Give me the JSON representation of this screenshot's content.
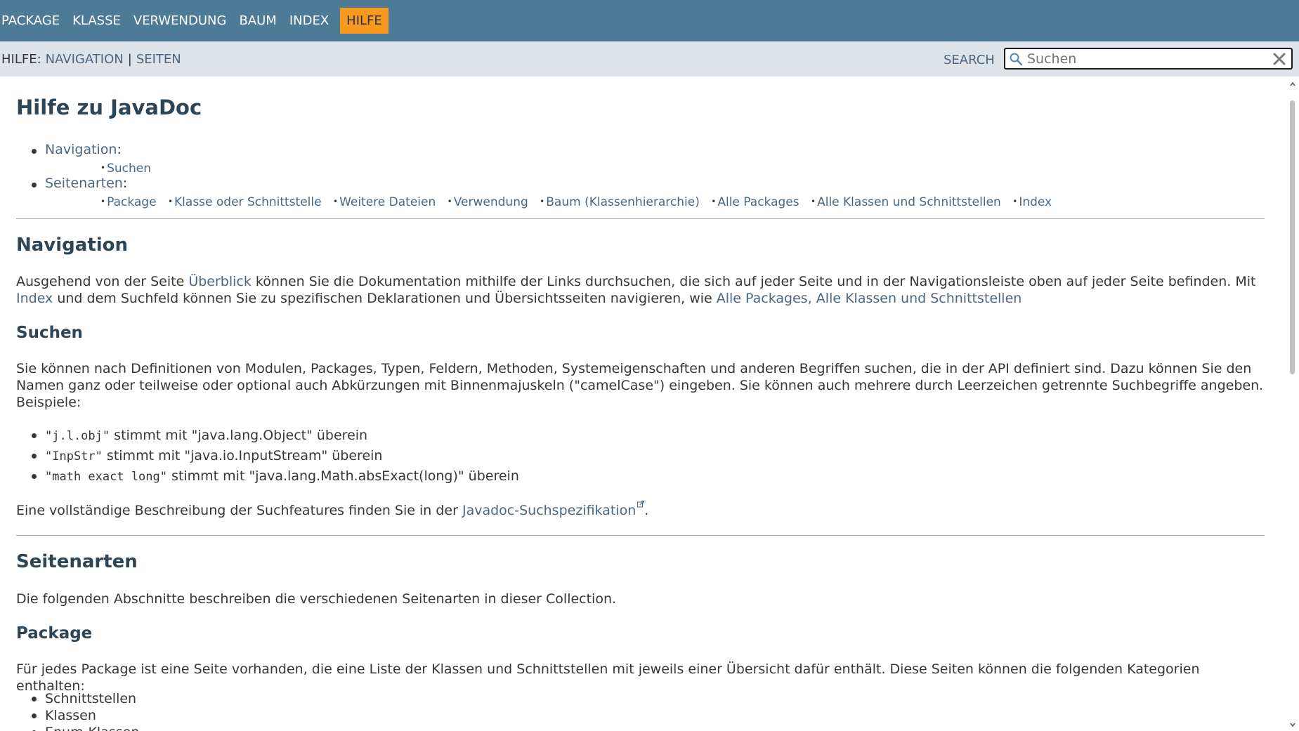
{
  "topnav": {
    "items": [
      "PACKAGE",
      "KLASSE",
      "VERWENDUNG",
      "BAUM",
      "INDEX"
    ],
    "active": "HILFE"
  },
  "subnav": {
    "help_prefix": "HILFE:",
    "nav_link": "NAVIGATION",
    "separator": "|",
    "pages_link": "SEITEN",
    "search_label": "SEARCH",
    "search_placeholder": "Suchen"
  },
  "page_title": "Hilfe zu JavaDoc",
  "toc": {
    "navigation_label": "Navigation",
    "navigation_items": [
      "Suchen"
    ],
    "pages_label": "Seitenarten",
    "pages_items": [
      "Package",
      "Klasse oder Schnittstelle",
      "Weitere Dateien",
      "Verwendung",
      "Baum (Klassenhierarchie)",
      "Alle Packages",
      "Alle Klassen und Schnittstellen",
      "Index"
    ],
    "colon": ":"
  },
  "navigation": {
    "heading": "Navigation",
    "text_1": "Ausgehend von der Seite ",
    "link_overview": "Überblick",
    "text_2": " können Sie die Dokumentation mithilfe der Links durchsuchen, die sich auf jeder Seite und in der Navigationsleiste oben auf jeder Seite befinden. Mit ",
    "link_index": "Index",
    "text_3": " und dem Suchfeld können Sie zu spezifischen Deklarationen und Übersichtsseiten navigieren, wie ",
    "link_all_packages": "Alle Packages",
    "comma": ", ",
    "link_all_classes": "Alle Klassen und Schnittstellen"
  },
  "search_section": {
    "heading": "Suchen",
    "text": "Sie können nach Definitionen von Modulen, Packages, Typen, Feldern, Methoden, Systemeigenschaften und anderen Begriffen suchen, die in der API definiert sind. Dazu können Sie den Namen ganz oder teilweise oder optional auch Abkürzungen mit Binnenmajuskeln (\"camelCase\") eingeben. Sie können auch mehrere durch Leerzeichen getrennte Suchbegriffe angeben. Beispiele:",
    "examples": [
      {
        "code": "\"j.l.obj\"",
        "text": " stimmt mit \"java.lang.Object\" überein"
      },
      {
        "code": "\"InpStr\"",
        "text": " stimmt mit \"java.io.InputStream\" überein"
      },
      {
        "code": "\"math exact long\"",
        "text": " stimmt mit \"java.lang.Math.absExact(long)\" überein"
      }
    ],
    "spec_text": "Eine vollständige Beschreibung der Suchfeatures finden Sie in der ",
    "spec_link": "Javadoc-Suchspezifikation",
    "spec_end": "."
  },
  "page_types": {
    "heading": "Seitenarten",
    "text": "Die folgenden Abschnitte beschreiben die verschiedenen Seitenarten in dieser Collection."
  },
  "package_section": {
    "heading": "Package",
    "text": "Für jedes Package ist eine Seite vorhanden, die eine Liste der Klassen und Schnittstellen mit jeweils einer Übersicht dafür enthält. Diese Seiten können die folgenden Kategorien enthalten:",
    "categories": [
      "Schnittstellen",
      "Klassen",
      "Enum-Klassen"
    ]
  },
  "colors": {
    "topnav_bg": "#4d7a97",
    "active_tab_bg": "#f8981d",
    "subnav_bg": "#dee3e9",
    "link": "#4a6782",
    "heading": "#2c4557"
  }
}
